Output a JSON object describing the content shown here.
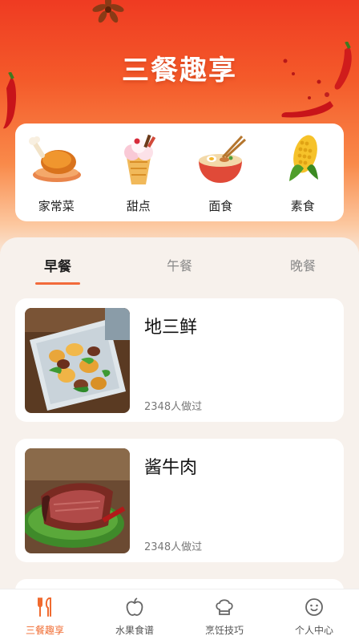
{
  "header": {
    "title": "三餐趣享"
  },
  "categories": [
    {
      "label": "家常菜",
      "icon": "roast-chicken-icon"
    },
    {
      "label": "甜点",
      "icon": "ice-cream-icon"
    },
    {
      "label": "面食",
      "icon": "noodle-bowl-icon"
    },
    {
      "label": "素食",
      "icon": "corn-icon"
    }
  ],
  "tabs": [
    {
      "label": "早餐",
      "active": true
    },
    {
      "label": "午餐",
      "active": false
    },
    {
      "label": "晚餐",
      "active": false
    }
  ],
  "recipes": [
    {
      "name": "地三鲜",
      "meta": "2348人做过",
      "image": "stir-fried-vegetables-photo"
    },
    {
      "name": "酱牛肉",
      "meta": "2348人做过",
      "image": "braised-beef-photo"
    }
  ],
  "bottom_nav": [
    {
      "label": "三餐趣享",
      "icon": "fork-knife-icon",
      "active": true
    },
    {
      "label": "水果食谱",
      "icon": "apple-icon",
      "active": false
    },
    {
      "label": "烹饪技巧",
      "icon": "chef-hat-icon",
      "active": false
    },
    {
      "label": "个人中心",
      "icon": "smiley-face-icon",
      "active": false
    }
  ],
  "colors": {
    "accent": "#f06a2f",
    "header_top": "#ef3b22",
    "background": "#f7f3ef"
  }
}
